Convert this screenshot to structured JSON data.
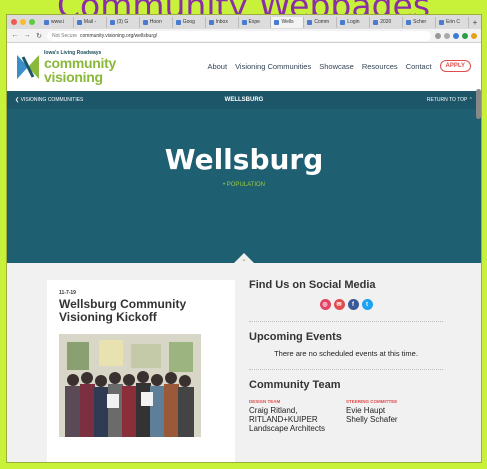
{
  "slide": {
    "title": "Community Webpages"
  },
  "browser": {
    "tabs": [
      "www.i",
      "Mail -",
      "(3) G",
      "Hoon",
      "Goog",
      "Inbox",
      "Expe",
      "Wells",
      "Comm",
      "Login",
      "2020",
      "Scher",
      "Erin C"
    ],
    "active_tab_index": 7,
    "new_tab": "+",
    "security": "Not Secure",
    "url": "community.visioning.org/wellsburg/"
  },
  "site": {
    "logo_small": "Iowa's Living Roadways",
    "logo_line1": "community",
    "logo_line2": "visioning",
    "nav": [
      "About",
      "Visioning Communities",
      "Showcase",
      "Resources",
      "Contact"
    ],
    "apply": "APPLY",
    "subnav_back": "VISIONING COMMUNITIES",
    "subnav_center": "WELLSBURG",
    "subnav_top": "RETURN TO TOP"
  },
  "hero": {
    "title": "Wellsburg",
    "subtitle": "• POPULATION"
  },
  "post": {
    "date": "11-7-19",
    "title": "Wellsburg Community Visioning Kickoff"
  },
  "sidebar": {
    "social_heading": "Find Us on Social Media",
    "events_heading": "Upcoming Events",
    "events_text": "There are no scheduled events at this time.",
    "team_heading": "Community Team",
    "design_label": "DESIGN TEAM",
    "design_names": "Craig Ritland, RITLAND+KUIPER Landscape Architects",
    "steering_label": "STEERING COMMITTEE",
    "steering_names": [
      "Evie Haupt",
      "Shelly Schafer"
    ]
  },
  "colors": {
    "slide_bg": "#c8f23a",
    "slide_title": "#8a2da8",
    "teal_dark": "#1d5669",
    "teal_hero": "#1f5f72",
    "green_accent": "#8ab83a",
    "red_accent": "#e04d4d"
  }
}
